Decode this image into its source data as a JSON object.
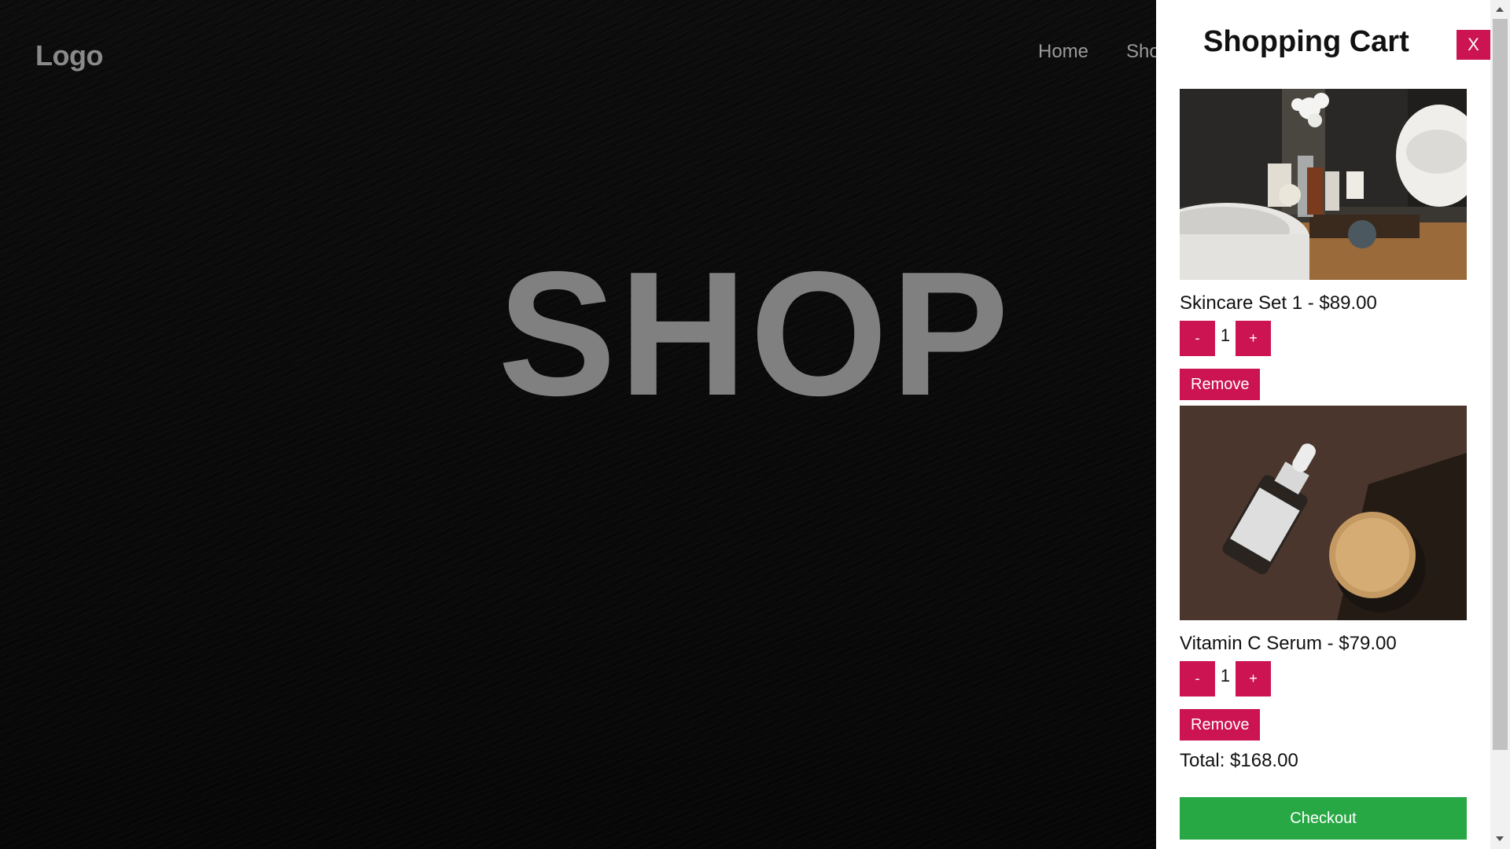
{
  "header": {
    "logo": "Logo",
    "nav": [
      "Home",
      "Sho"
    ]
  },
  "hero": {
    "title": "SHOP"
  },
  "cart": {
    "title": "Shopping Cart",
    "close_label": "X",
    "items": [
      {
        "name": "Skincare Set 1 - $89.00",
        "quantity": "1",
        "minus_label": "-",
        "plus_label": "+",
        "remove_label": "Remove"
      },
      {
        "name": "Vitamin C Serum - $79.00",
        "quantity": "1",
        "minus_label": "-",
        "plus_label": "+",
        "remove_label": "Remove"
      }
    ],
    "total": "Total: $168.00",
    "checkout_label": "Checkout"
  },
  "colors": {
    "accent": "#cc1452",
    "checkout": "#28a745",
    "hero_text": "#808080"
  }
}
